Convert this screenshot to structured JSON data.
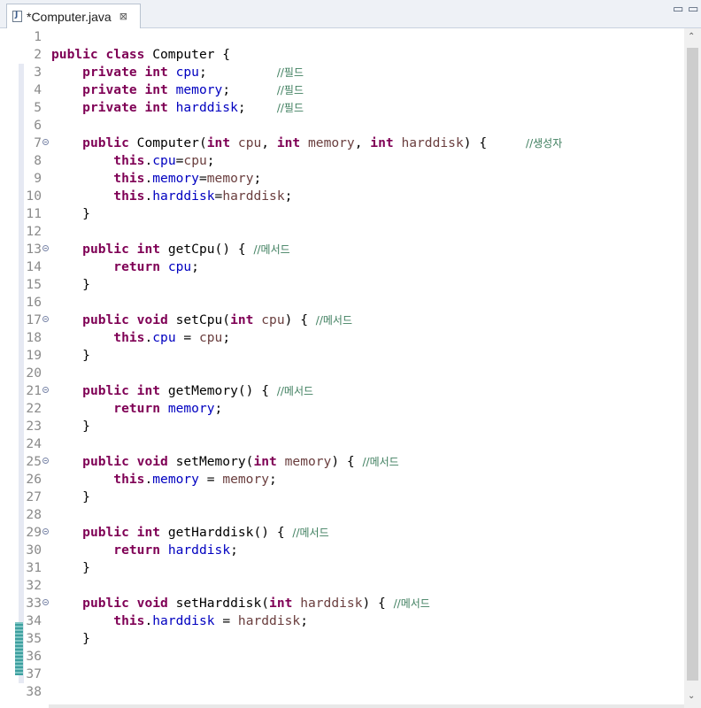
{
  "tab": {
    "title": "*Computer.java",
    "close": "⊠",
    "icon": "java-file-icon"
  },
  "window": {
    "minimize": "▭",
    "maximize": "▭"
  },
  "colors": {
    "keyword": "#7f0055",
    "field": "#0000c0",
    "param": "#6a3e3e",
    "comment": "#3f7f5f"
  },
  "line_numbers": [
    "1",
    "2",
    "3",
    "4",
    "5",
    "6",
    "7",
    "8",
    "9",
    "10",
    "11",
    "12",
    "13",
    "14",
    "15",
    "16",
    "17",
    "18",
    "19",
    "20",
    "21",
    "22",
    "23",
    "24",
    "25",
    "26",
    "27",
    "28",
    "29",
    "30",
    "31",
    "32",
    "33",
    "34",
    "35",
    "36",
    "37",
    "38"
  ],
  "fold_lines": [
    "7",
    "13",
    "17",
    "21",
    "25",
    "29",
    "33"
  ],
  "code": [
    [],
    [
      [
        "kw",
        "public class "
      ],
      [
        "",
        "Computer {"
      ]
    ],
    [
      [
        "",
        "    "
      ],
      [
        "kw",
        "private int "
      ],
      [
        "fld",
        "cpu"
      ],
      [
        "",
        ";         "
      ],
      [
        "cmt",
        "//필드"
      ]
    ],
    [
      [
        "",
        "    "
      ],
      [
        "kw",
        "private int "
      ],
      [
        "fld",
        "memory"
      ],
      [
        "",
        ";      "
      ],
      [
        "cmt",
        "//필드"
      ]
    ],
    [
      [
        "",
        "    "
      ],
      [
        "kw",
        "private int "
      ],
      [
        "fld",
        "harddisk"
      ],
      [
        "",
        ";    "
      ],
      [
        "cmt",
        "//필드"
      ]
    ],
    [],
    [
      [
        "",
        "    "
      ],
      [
        "kw",
        "public "
      ],
      [
        "",
        "Computer("
      ],
      [
        "kw",
        "int "
      ],
      [
        "prm",
        "cpu"
      ],
      [
        "",
        ", "
      ],
      [
        "kw",
        "int "
      ],
      [
        "prm",
        "memory"
      ],
      [
        "",
        ", "
      ],
      [
        "kw",
        "int "
      ],
      [
        "prm",
        "harddisk"
      ],
      [
        "",
        ") {     "
      ],
      [
        "cmt",
        "//생성자"
      ]
    ],
    [
      [
        "",
        "        "
      ],
      [
        "kw",
        "this"
      ],
      [
        "",
        "."
      ],
      [
        "fld",
        "cpu"
      ],
      [
        "",
        "="
      ],
      [
        "prm",
        "cpu"
      ],
      [
        "",
        ";"
      ]
    ],
    [
      [
        "",
        "        "
      ],
      [
        "kw",
        "this"
      ],
      [
        "",
        "."
      ],
      [
        "fld",
        "memory"
      ],
      [
        "",
        "="
      ],
      [
        "prm",
        "memory"
      ],
      [
        "",
        ";"
      ]
    ],
    [
      [
        "",
        "        "
      ],
      [
        "kw",
        "this"
      ],
      [
        "",
        "."
      ],
      [
        "fld",
        "harddisk"
      ],
      [
        "",
        "="
      ],
      [
        "prm",
        "harddisk"
      ],
      [
        "",
        ";"
      ]
    ],
    [
      [
        "",
        "    }"
      ]
    ],
    [],
    [
      [
        "",
        "    "
      ],
      [
        "kw",
        "public int "
      ],
      [
        "",
        "getCpu() { "
      ],
      [
        "cmt",
        "//메서드"
      ]
    ],
    [
      [
        "",
        "        "
      ],
      [
        "kw",
        "return "
      ],
      [
        "fld",
        "cpu"
      ],
      [
        "",
        ";"
      ]
    ],
    [
      [
        "",
        "    }"
      ]
    ],
    [],
    [
      [
        "",
        "    "
      ],
      [
        "kw",
        "public void "
      ],
      [
        "",
        "setCpu("
      ],
      [
        "kw",
        "int "
      ],
      [
        "prm",
        "cpu"
      ],
      [
        "",
        ") { "
      ],
      [
        "cmt",
        "//메서드"
      ]
    ],
    [
      [
        "",
        "        "
      ],
      [
        "kw",
        "this"
      ],
      [
        "",
        "."
      ],
      [
        "fld",
        "cpu"
      ],
      [
        "",
        " = "
      ],
      [
        "prm",
        "cpu"
      ],
      [
        "",
        ";"
      ]
    ],
    [
      [
        "",
        "    }"
      ]
    ],
    [],
    [
      [
        "",
        "    "
      ],
      [
        "kw",
        "public int "
      ],
      [
        "",
        "getMemory() { "
      ],
      [
        "cmt",
        "//메서드"
      ]
    ],
    [
      [
        "",
        "        "
      ],
      [
        "kw",
        "return "
      ],
      [
        "fld",
        "memory"
      ],
      [
        "",
        ";"
      ]
    ],
    [
      [
        "",
        "    }"
      ]
    ],
    [],
    [
      [
        "",
        "    "
      ],
      [
        "kw",
        "public void "
      ],
      [
        "",
        "setMemory("
      ],
      [
        "kw",
        "int "
      ],
      [
        "prm",
        "memory"
      ],
      [
        "",
        ") { "
      ],
      [
        "cmt",
        "//메서드"
      ]
    ],
    [
      [
        "",
        "        "
      ],
      [
        "kw",
        "this"
      ],
      [
        "",
        "."
      ],
      [
        "fld",
        "memory"
      ],
      [
        "",
        " = "
      ],
      [
        "prm",
        "memory"
      ],
      [
        "",
        ";"
      ]
    ],
    [
      [
        "",
        "    }"
      ]
    ],
    [],
    [
      [
        "",
        "    "
      ],
      [
        "kw",
        "public int "
      ],
      [
        "",
        "getHarddisk() { "
      ],
      [
        "cmt",
        "//메서드"
      ]
    ],
    [
      [
        "",
        "        "
      ],
      [
        "kw",
        "return "
      ],
      [
        "fld",
        "harddisk"
      ],
      [
        "",
        ";"
      ]
    ],
    [
      [
        "",
        "    }"
      ]
    ],
    [],
    [
      [
        "",
        "    "
      ],
      [
        "kw",
        "public void "
      ],
      [
        "",
        "setHarddisk("
      ],
      [
        "kw",
        "int "
      ],
      [
        "prm",
        "harddisk"
      ],
      [
        "",
        ") { "
      ],
      [
        "cmt",
        "//메서드"
      ]
    ],
    [
      [
        "",
        "        "
      ],
      [
        "kw",
        "this"
      ],
      [
        "",
        "."
      ],
      [
        "fld",
        "harddisk"
      ],
      [
        "",
        " = "
      ],
      [
        "prm",
        "harddisk"
      ],
      [
        "",
        ";"
      ]
    ],
    [
      [
        "",
        "    }"
      ]
    ],
    [],
    [],
    []
  ],
  "scrollbar": {
    "up": "⌃",
    "down": "⌄"
  }
}
